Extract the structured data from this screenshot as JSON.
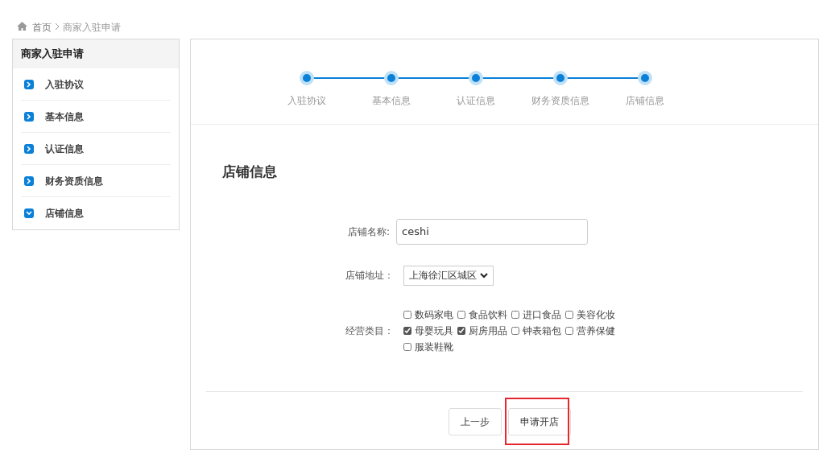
{
  "breadcrumb": [
    {
      "label": "首页"
    },
    {
      "label": "商家入驻申请"
    }
  ],
  "sidebar": {
    "title": "商家入驻申请",
    "items": [
      {
        "label": "入驻协议",
        "expanded": false
      },
      {
        "label": "基本信息",
        "expanded": false
      },
      {
        "label": "认证信息",
        "expanded": false
      },
      {
        "label": "财务资质信息",
        "expanded": false
      },
      {
        "label": "店铺信息",
        "expanded": true
      }
    ]
  },
  "steps": [
    {
      "label": "入驻协议"
    },
    {
      "label": "基本信息"
    },
    {
      "label": "认证信息"
    },
    {
      "label": "财务资质信息"
    },
    {
      "label": "店铺信息"
    }
  ],
  "form": {
    "heading": "店铺信息",
    "shop_name": {
      "label": "店铺名称:",
      "value": "ceshi"
    },
    "address": {
      "label": "店铺地址：",
      "value": "上海徐汇区城区"
    },
    "categories": {
      "label": "经营类目：",
      "options": [
        {
          "label": "数码家电",
          "checked": false
        },
        {
          "label": "食品饮料",
          "checked": false
        },
        {
          "label": "进口食品",
          "checked": false
        },
        {
          "label": "美容化妆",
          "checked": false
        },
        {
          "label": "母婴玩具",
          "checked": true
        },
        {
          "label": "厨房用品",
          "checked": true
        },
        {
          "label": "钟表箱包",
          "checked": false
        },
        {
          "label": "营养保健",
          "checked": false
        },
        {
          "label": "服装鞋靴",
          "checked": false
        }
      ]
    }
  },
  "buttons": [
    {
      "label": "上一步",
      "highlighted": false
    },
    {
      "label": "申请开店",
      "highlighted": true
    }
  ]
}
